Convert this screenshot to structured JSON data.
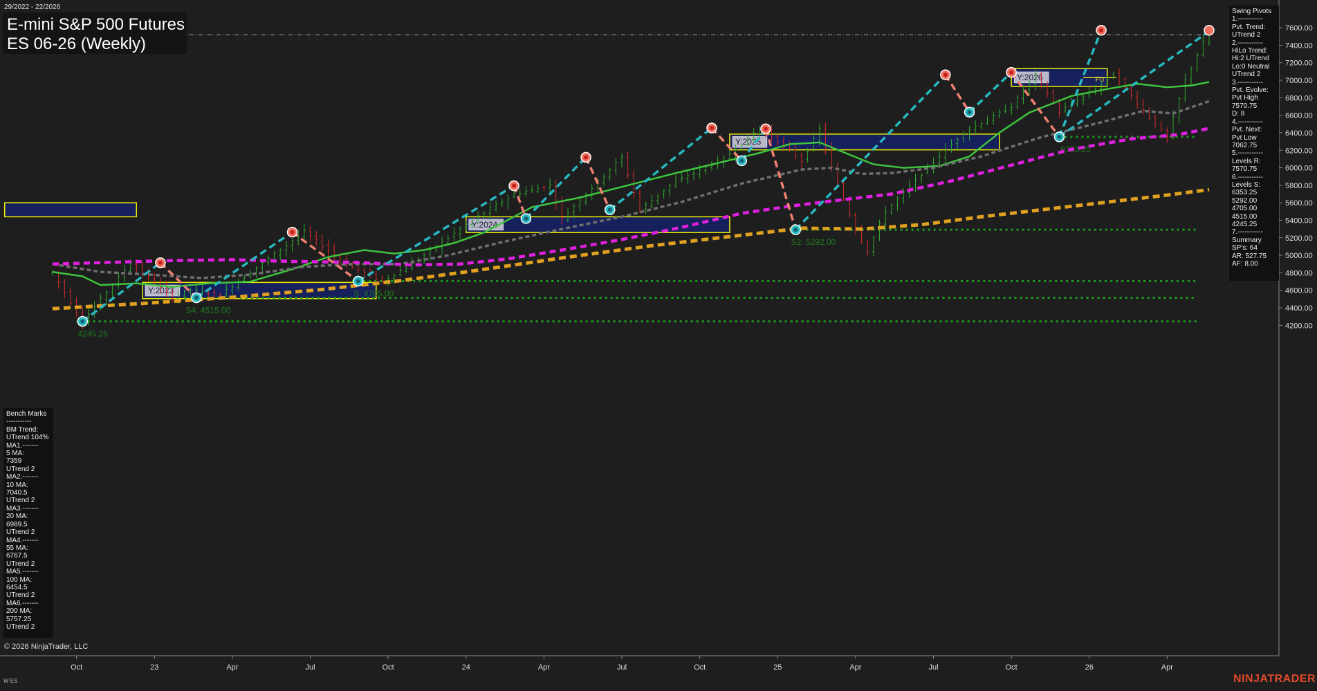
{
  "header": {
    "date_range": "29/2022 - 22/2026",
    "title": "E-mini S&P 500 Futures",
    "subtitle": "ES 06-26 (Weekly)"
  },
  "footer": {
    "copyright": "© 2026 NinjaTrader, LLC",
    "instrument_tag": "W ES",
    "brand": "NINJATRADER"
  },
  "colors": {
    "background": "#1e1e1e",
    "up_bar": "#2fa82f",
    "down_bar": "#d42a2a",
    "ma_green": "#3ec43e",
    "ma_gray": "#6e6e6e",
    "ma_magenta": "#e020e0",
    "ma_orange": "#e0a020",
    "swing_up": "#28b8c0",
    "swing_down": "#f08070",
    "zone_fill": "#16205c",
    "zone_border": "#f0f000",
    "support_line": "#1e9e1e"
  },
  "swing_panel": [
    "Swing Pivots",
    "1.-----------",
    "Pvt. Trend:",
    "UTrend 2",
    "2.-----------",
    "HiLo Trend:",
    "Hi:2 UTrend",
    "Lo:0 Neutral",
    "UTrend 2",
    "3.-----------",
    "Pvt. Evolve:",
    "Pvt High",
    "7570.75",
    "D: 8",
    "4.-----------",
    "Pvt. Next:",
    "Pvt Low",
    "7062.75",
    "5.-----------",
    "Levels R:",
    "7570.75",
    "6.-----------",
    "Levels S:",
    "6353.25",
    "5292.00",
    "4705.00",
    "4515.00",
    "4245.25",
    "7.-----------",
    "Summary",
    "SP's: 64",
    "AR: 527.75",
    "AF: 8.00"
  ],
  "bench_panel": [
    "Bench Marks",
    "-----------",
    "BM Trend:",
    "UTrend 104%",
    "MA1.-------",
    "5 MA:",
    "7359",
    "UTrend 2",
    "MA2.-------",
    "10 MA:",
    "7040.5",
    "UTrend 2",
    "MA3.-------",
    "20 MA:",
    "6989.5",
    "UTrend 2",
    "MA4.-------",
    "55 MA:",
    "6767.5",
    "UTrend 2",
    "MA5.-------",
    "100 MA:",
    "6454.5",
    "UTrend 2",
    "MA6.-------",
    "200 MA:",
    "5757.25",
    "UTrend 2"
  ],
  "chart_data": {
    "type": "candlestick",
    "title": "E-mini S&P 500 Futures",
    "subtitle": "ES 06-26 (Weekly)",
    "ylim": [
      4100,
      7720
    ],
    "y_ticks": [
      4200,
      4400,
      4600,
      4800,
      5000,
      5200,
      5400,
      5600,
      5800,
      6000,
      6200,
      6400,
      6600,
      6800,
      7000,
      7200,
      7400,
      7600
    ],
    "x_ticks": [
      {
        "label": "Oct",
        "week": 4
      },
      {
        "label": "23",
        "week": 17
      },
      {
        "label": "Apr",
        "week": 30
      },
      {
        "label": "Jul",
        "week": 43
      },
      {
        "label": "Oct",
        "week": 56
      },
      {
        "label": "24",
        "week": 69
      },
      {
        "label": "Apr",
        "week": 82
      },
      {
        "label": "Jul",
        "week": 95
      },
      {
        "label": "Oct",
        "week": 108
      },
      {
        "label": "25",
        "week": 121
      },
      {
        "label": "Apr",
        "week": 134
      },
      {
        "label": "Jul",
        "week": 147
      },
      {
        "label": "Oct",
        "week": 160
      },
      {
        "label": "26",
        "week": 173
      },
      {
        "label": "Apr",
        "week": 186
      }
    ],
    "price_anchors": [
      [
        0,
        4800
      ],
      [
        5,
        4245.25
      ],
      [
        13,
        4915
      ],
      [
        20,
        4515
      ],
      [
        23,
        4605
      ],
      [
        28,
        4550
      ],
      [
        42,
        5270
      ],
      [
        49,
        4900
      ],
      [
        55,
        4705
      ],
      [
        60,
        4900
      ],
      [
        70,
        5400
      ],
      [
        77,
        5700
      ],
      [
        83,
        5800
      ],
      [
        85,
        5420
      ],
      [
        95,
        6120
      ],
      [
        98,
        5520
      ],
      [
        104,
        5850
      ],
      [
        112,
        6100
      ],
      [
        118,
        6455
      ],
      [
        123,
        6200
      ],
      [
        125,
        6080
      ],
      [
        128,
        6445
      ],
      [
        130,
        6000
      ],
      [
        134,
        5292
      ],
      [
        136,
        5050
      ],
      [
        139,
        5500
      ],
      [
        146,
        6000
      ],
      [
        152,
        6400
      ],
      [
        160,
        6700
      ],
      [
        164,
        7060
      ],
      [
        168,
        6640
      ],
      [
        175,
        6950
      ],
      [
        177,
        7080
      ],
      [
        180,
        6820
      ],
      [
        184,
        6500
      ],
      [
        186,
        6353.25
      ],
      [
        189,
        7000
      ],
      [
        193,
        7570.75
      ]
    ],
    "moving_averages": [
      {
        "name": "5 MA",
        "last": 7359
      },
      {
        "name": "10 MA",
        "last": 7040.5
      },
      {
        "name": "20 MA",
        "last": 6989.5,
        "color": "#3ec43e",
        "points": [
          [
            0,
            4810
          ],
          [
            5,
            4760
          ],
          [
            8,
            4660
          ],
          [
            14,
            4680
          ],
          [
            20,
            4640
          ],
          [
            26,
            4680
          ],
          [
            33,
            4700
          ],
          [
            40,
            4840
          ],
          [
            46,
            4980
          ],
          [
            52,
            5060
          ],
          [
            57,
            5020
          ],
          [
            62,
            5060
          ],
          [
            67,
            5140
          ],
          [
            72,
            5260
          ],
          [
            80,
            5550
          ],
          [
            88,
            5660
          ],
          [
            96,
            5800
          ],
          [
            104,
            5940
          ],
          [
            112,
            6070
          ],
          [
            118,
            6170
          ],
          [
            123,
            6270
          ],
          [
            128,
            6290
          ],
          [
            133,
            6150
          ],
          [
            137,
            6040
          ],
          [
            142,
            6000
          ],
          [
            148,
            6020
          ],
          [
            153,
            6130
          ],
          [
            158,
            6400
          ],
          [
            163,
            6630
          ],
          [
            170,
            6820
          ],
          [
            176,
            6900
          ],
          [
            181,
            6960
          ],
          [
            186,
            6920
          ],
          [
            190,
            6940
          ],
          [
            193,
            6980
          ]
        ]
      },
      {
        "name": "55 MA",
        "last": 6767.5,
        "color": "#6e6e6e",
        "points": [
          [
            0,
            4900
          ],
          [
            8,
            4810
          ],
          [
            16,
            4780
          ],
          [
            25,
            4740
          ],
          [
            33,
            4780
          ],
          [
            42,
            4870
          ],
          [
            50,
            4900
          ],
          [
            58,
            4900
          ],
          [
            66,
            5000
          ],
          [
            75,
            5150
          ],
          [
            85,
            5300
          ],
          [
            95,
            5440
          ],
          [
            105,
            5610
          ],
          [
            115,
            5820
          ],
          [
            125,
            5980
          ],
          [
            130,
            6000
          ],
          [
            135,
            5930
          ],
          [
            140,
            5940
          ],
          [
            147,
            6000
          ],
          [
            155,
            6130
          ],
          [
            165,
            6350
          ],
          [
            175,
            6520
          ],
          [
            182,
            6650
          ],
          [
            187,
            6620
          ],
          [
            193,
            6760
          ]
        ]
      },
      {
        "name": "100 MA",
        "last": 6454.5,
        "color": "#e020e0",
        "points": [
          [
            0,
            4900
          ],
          [
            10,
            4920
          ],
          [
            20,
            4940
          ],
          [
            30,
            4950
          ],
          [
            40,
            4930
          ],
          [
            50,
            4920
          ],
          [
            60,
            4890
          ],
          [
            68,
            4900
          ],
          [
            76,
            4960
          ],
          [
            85,
            5060
          ],
          [
            95,
            5180
          ],
          [
            105,
            5320
          ],
          [
            115,
            5480
          ],
          [
            123,
            5560
          ],
          [
            130,
            5620
          ],
          [
            140,
            5700
          ],
          [
            150,
            5850
          ],
          [
            160,
            6030
          ],
          [
            170,
            6210
          ],
          [
            180,
            6330
          ],
          [
            188,
            6380
          ],
          [
            193,
            6450
          ]
        ]
      },
      {
        "name": "200 MA",
        "last": 5757.25,
        "color": "#e0a020",
        "points": [
          [
            0,
            4390
          ],
          [
            15,
            4450
          ],
          [
            30,
            4520
          ],
          [
            45,
            4610
          ],
          [
            58,
            4710
          ],
          [
            70,
            4820
          ],
          [
            85,
            4970
          ],
          [
            100,
            5110
          ],
          [
            115,
            5230
          ],
          [
            125,
            5310
          ],
          [
            135,
            5300
          ],
          [
            145,
            5350
          ],
          [
            155,
            5440
          ],
          [
            165,
            5520
          ],
          [
            175,
            5600
          ],
          [
            185,
            5680
          ],
          [
            193,
            5750
          ]
        ]
      }
    ],
    "swing_pivots": [
      {
        "week": 5,
        "price": 4245.25,
        "type": "low"
      },
      {
        "week": 18,
        "price": 4915,
        "type": "high"
      },
      {
        "week": 24,
        "price": 4515,
        "type": "low"
      },
      {
        "week": 40,
        "price": 5265,
        "type": "high"
      },
      {
        "week": 51,
        "price": 4705,
        "type": "low"
      },
      {
        "week": 77,
        "price": 5795,
        "type": "high"
      },
      {
        "week": 79,
        "price": 5420,
        "type": "low"
      },
      {
        "week": 89,
        "price": 6120,
        "type": "high"
      },
      {
        "week": 93,
        "price": 5520,
        "type": "low"
      },
      {
        "week": 110,
        "price": 6455,
        "type": "high"
      },
      {
        "week": 115,
        "price": 6080,
        "type": "low"
      },
      {
        "week": 119,
        "price": 6445,
        "type": "high"
      },
      {
        "week": 124,
        "price": 5292,
        "type": "low"
      },
      {
        "week": 149,
        "price": 7062.75,
        "type": "high"
      },
      {
        "week": 153,
        "price": 6635,
        "type": "low"
      },
      {
        "week": 160,
        "price": 7090,
        "type": "high"
      },
      {
        "week": 168,
        "price": 6353.25,
        "type": "low"
      },
      {
        "week": 175,
        "price": 7570.75,
        "type": "high"
      }
    ],
    "year_zones": [
      {
        "label": "Y:2023",
        "w0": 15,
        "w1": 54,
        "ylo": 4505,
        "yhi": 4690
      },
      {
        "label": "Y:2024",
        "w0": 69,
        "w1": 113,
        "ylo": 5260,
        "yhi": 5440
      },
      {
        "label": "Y:2025",
        "w0": 113,
        "w1": 158,
        "ylo": 6205,
        "yhi": 6385
      },
      {
        "label": "Y:2026",
        "w0": 160,
        "w1": 176,
        "ylo": 6930,
        "yhi": 7135
      },
      {
        "label": "",
        "w0": -8,
        "w1": 14,
        "ylo": 5440,
        "yhi": 5600
      }
    ],
    "support_levels": [
      {
        "label": "S4: 4515.00",
        "value": 4515,
        "w0": 22
      },
      {
        "label": "S: 4705.00",
        "value": 4705,
        "w0": 50
      },
      {
        "label": "S2: 5292.00",
        "value": 5292,
        "w0": 123
      },
      {
        "label": "6353.25",
        "value": 6353.25,
        "w0": 168
      },
      {
        "label": "4245.25",
        "value": 4245.25,
        "w0": 4
      }
    ],
    "resistance_line": 7520,
    "f0_label": "F0"
  }
}
